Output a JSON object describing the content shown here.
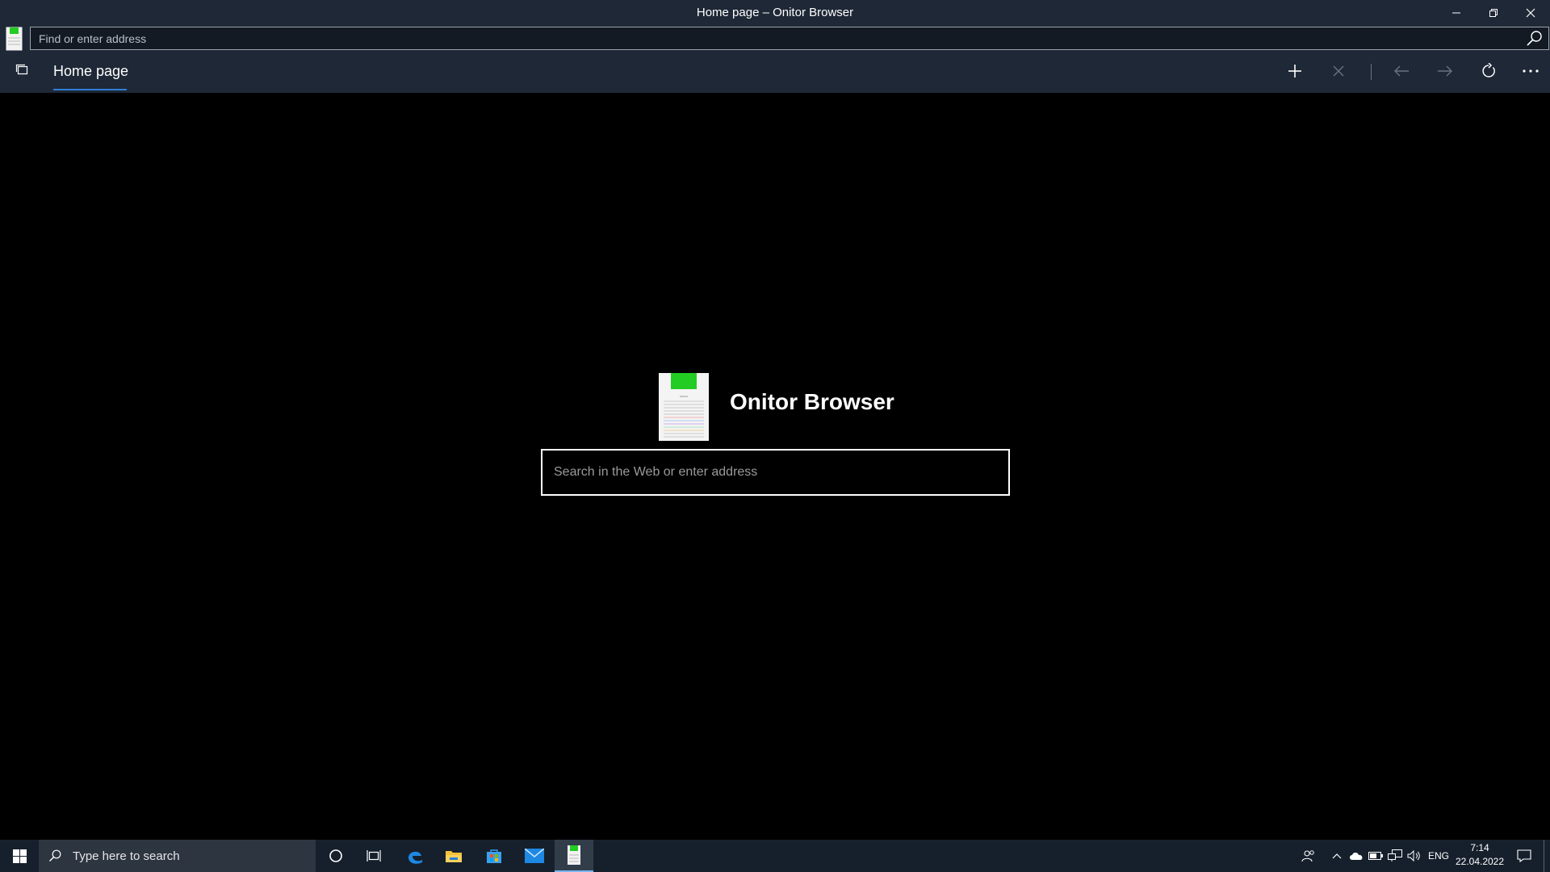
{
  "window": {
    "title": "Home page – Onitor Browser",
    "controls": [
      "minimize-icon",
      "restore-icon",
      "close-icon"
    ]
  },
  "address_bar": {
    "placeholder": "Find or enter address",
    "search_icon": "search-icon"
  },
  "tabs": [
    {
      "label": "Home page",
      "active": true
    }
  ],
  "toolbar": {
    "buttons": [
      "add-tab-icon",
      "close-tab-icon",
      "back-icon",
      "forward-icon",
      "refresh-icon",
      "more-icon"
    ]
  },
  "home": {
    "brand_name": "Onitor Browser",
    "search_placeholder": "Search in the Web or enter address"
  },
  "taskbar": {
    "search_placeholder": "Type here to search",
    "apps": [
      "cortana-icon",
      "task-view-icon",
      "edge-icon",
      "file-explorer-icon",
      "store-icon",
      "mail-icon",
      "onitor-browser-icon"
    ],
    "tray": {
      "language": "ENG",
      "time": "7:14",
      "date": "22.04.2022"
    }
  },
  "colors": {
    "chrome_bg": "#1e2836",
    "content_bg": "#000000",
    "accent": "#2f7fd8",
    "taskbar_bg": "#16202c",
    "logo_green": "#22cc22"
  }
}
